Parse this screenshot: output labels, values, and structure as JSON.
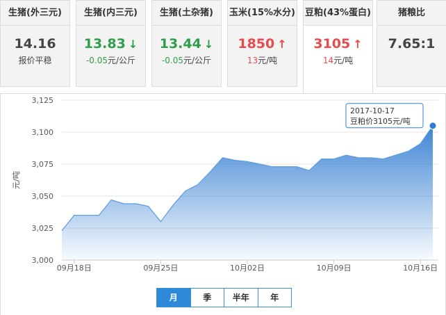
{
  "tabs": [
    {
      "title": "生猪(外三元)",
      "value": "14.16",
      "arrow": "",
      "sub": "报价平稳",
      "tone": "black"
    },
    {
      "title": "生猪(内三元)",
      "value": "13.83",
      "arrow": "↓",
      "sub": "-0.05元/公斤",
      "tone": "green"
    },
    {
      "title": "生猪(土杂猪)",
      "value": "13.44",
      "arrow": "↓",
      "sub": "-0.05元/公斤",
      "tone": "green"
    },
    {
      "title": "玉米(15%水分)",
      "value": "1850",
      "arrow": "↑",
      "sub": "13元/吨",
      "tone": "red"
    },
    {
      "title": "豆粕(43%蛋白)",
      "value": "3105",
      "arrow": "↑",
      "sub": "14元/吨",
      "tone": "red"
    },
    {
      "title": "猪粮比",
      "value": "7.65:1",
      "arrow": "",
      "sub": "",
      "tone": "black"
    }
  ],
  "active_tab": 4,
  "ranges": [
    "月",
    "季",
    "半年",
    "年"
  ],
  "active_range": 0,
  "colors": {
    "accent": "#2e89d8",
    "up": "#e84b4b",
    "down": "#2e9e48"
  },
  "chart_data": {
    "type": "area",
    "title": "",
    "xlabel": "",
    "ylabel": "元/吨",
    "ylim": [
      3000,
      3125
    ],
    "yticks": [
      3000,
      3025,
      3050,
      3075,
      3100,
      3125
    ],
    "ytick_labels": [
      "3,000",
      "3,025",
      "3,050",
      "3,075",
      "3,100",
      "3,125"
    ],
    "xtick_labels": [
      "09月18日",
      "09月25日",
      "10月02日",
      "10月09日",
      "10月16日"
    ],
    "xtick_dates": [
      "2017-09-18",
      "2017-09-25",
      "2017-10-02",
      "2017-10-09",
      "2017-10-16"
    ],
    "grid": true,
    "x": [
      "2017-09-17",
      "2017-09-18",
      "2017-09-19",
      "2017-09-20",
      "2017-09-21",
      "2017-09-22",
      "2017-09-23",
      "2017-09-24",
      "2017-09-25",
      "2017-09-26",
      "2017-09-27",
      "2017-09-28",
      "2017-09-29",
      "2017-09-30",
      "2017-10-01",
      "2017-10-02",
      "2017-10-03",
      "2017-10-04",
      "2017-10-05",
      "2017-10-06",
      "2017-10-07",
      "2017-10-08",
      "2017-10-09",
      "2017-10-10",
      "2017-10-11",
      "2017-10-12",
      "2017-10-13",
      "2017-10-14",
      "2017-10-15",
      "2017-10-16",
      "2017-10-17"
    ],
    "series": [
      {
        "values": [
          3023,
          3035,
          3035,
          3035,
          3047,
          3044,
          3044,
          3042,
          3030,
          3043,
          3054,
          3059,
          3069,
          3080,
          3078,
          3077,
          3075,
          3073,
          3073,
          3073,
          3070,
          3079,
          3079,
          3082,
          3080,
          3080,
          3079,
          3082,
          3085,
          3091,
          3105
        ]
      }
    ],
    "tooltip": {
      "date": "2017-10-17",
      "text": "豆粕价3105元/吨"
    }
  }
}
